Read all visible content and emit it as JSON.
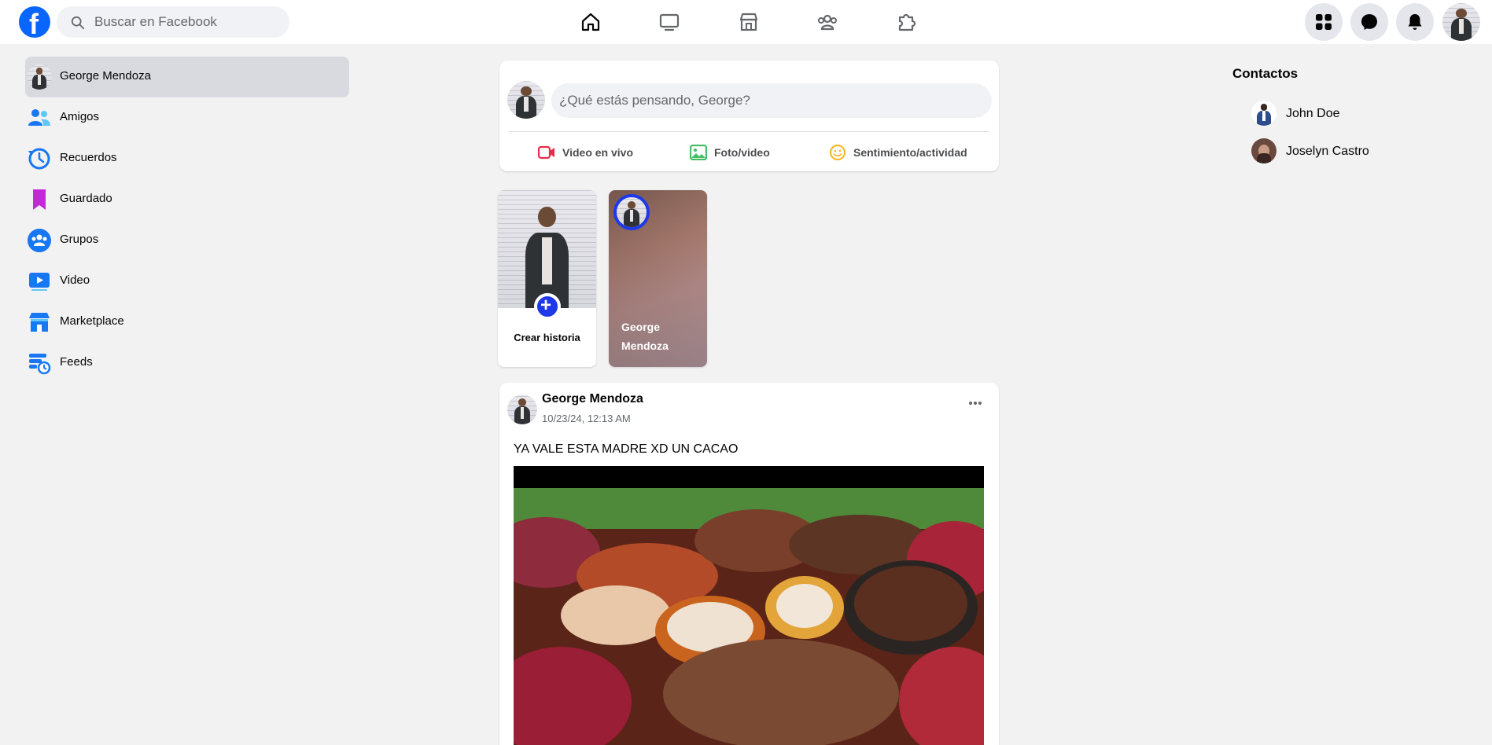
{
  "header": {
    "logo_letter": "f",
    "search_placeholder": "Buscar en Facebook",
    "nav_icons": [
      "home-icon",
      "watch-icon",
      "marketplace-icon",
      "groups-icon",
      "gaming-icon"
    ],
    "right_icons": [
      "menu-grid-icon",
      "messenger-icon",
      "notifications-icon"
    ]
  },
  "sidebar": {
    "items": [
      {
        "label": "George Mendoza",
        "icon": "user-avatar"
      },
      {
        "label": "Amigos",
        "icon": "friends-icon"
      },
      {
        "label": "Recuerdos",
        "icon": "memories-icon"
      },
      {
        "label": "Guardado",
        "icon": "saved-icon"
      },
      {
        "label": "Grupos",
        "icon": "groups-icon"
      },
      {
        "label": "Video",
        "icon": "video-icon"
      },
      {
        "label": "Marketplace",
        "icon": "marketplace-icon"
      },
      {
        "label": "Feeds",
        "icon": "feeds-icon"
      }
    ]
  },
  "composer": {
    "placeholder": "¿Qué estás pensando, George?",
    "actions": [
      {
        "label": "Video en vivo",
        "icon": "live-video-icon",
        "color": "#f02849"
      },
      {
        "label": "Foto/video",
        "icon": "photo-icon",
        "color": "#45bd62"
      },
      {
        "label": "Sentimiento/actividad",
        "icon": "feeling-icon",
        "color": "#f7b928"
      }
    ]
  },
  "stories": {
    "create_label": "Crear historia",
    "items": [
      {
        "name": "George Mendoza"
      }
    ]
  },
  "post": {
    "author": "George Mendoza",
    "timestamp": "10/23/24, 12:13 AM",
    "text": "YA VALE ESTA MADRE XD UN CACAO",
    "image_alt": "cacao pods and beans"
  },
  "contacts": {
    "title": "Contactos",
    "items": [
      {
        "name": "John Doe"
      },
      {
        "name": "Joselyn Castro"
      }
    ]
  },
  "colors": {
    "brand": "#0866ff",
    "story_accent": "#1e3ae8",
    "background": "#f2f2f3"
  }
}
